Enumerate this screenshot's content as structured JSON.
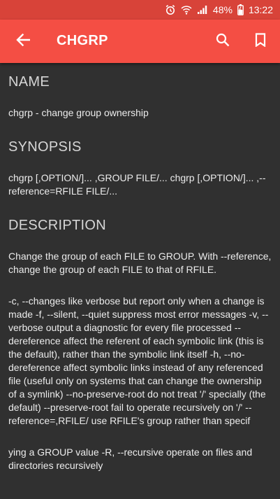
{
  "status_bar": {
    "battery": "48%",
    "time": "13:22"
  },
  "app_bar": {
    "title": "CHGRP"
  },
  "sections": [
    {
      "heading": "NAME",
      "paragraphs": [
        "chgrp - change group ownership"
      ]
    },
    {
      "heading": "SYNOPSIS",
      "paragraphs": [
        "chgrp [,OPTION/]... ,GROUP FILE/... chgrp [,OPTION/]... ,--reference=RFILE FILE/..."
      ]
    },
    {
      "heading": "DESCRIPTION",
      "paragraphs": [
        "Change the group of each FILE to GROUP. With --reference, change the group of each FILE to that of RFILE.",
        "-c, --changes like verbose but report only when a change is made -f, --silent, --quiet suppress most error messages -v, --verbose output a diagnostic for every file processed --dereference affect the referent of each symbolic link (this is the default), rather than the symbolic link itself -h, --no-dereference affect symbolic links instead of any referenced file (useful only on systems that can change the ownership of a symlink) --no-preserve-root do not treat '/' specially (the default) --preserve-root fail to operate recursively on '/' --reference=,RFILE/ use RFILE's group rather than specif",
        "ying a GROUP value -R, --recursive operate on files and directories recursively"
      ]
    }
  ],
  "icons": {
    "back": "arrow-left-icon",
    "search": "search-icon",
    "bookmark": "bookmark-icon"
  },
  "colors": {
    "status_bar": "#d84339",
    "app_bar": "#f44e44",
    "background": "#303030"
  }
}
